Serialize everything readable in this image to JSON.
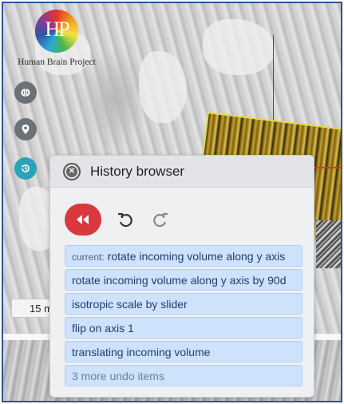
{
  "logo": {
    "mark": "HP",
    "text": "Human Brain Project"
  },
  "sidebar": {
    "buttons": [
      {
        "icon": "brain-icon"
      },
      {
        "icon": "map-pin-icon"
      },
      {
        "icon": "history-icon",
        "active": true
      }
    ]
  },
  "scale_label": "15 m",
  "history": {
    "title": "History browser",
    "close_icon": "close-icon",
    "controls": {
      "rewind_icon": "rewind-icon",
      "undo_icon": "undo-icon",
      "redo_icon": "redo-icon"
    },
    "current_prefix": "current:",
    "items": [
      "rotate incoming volume along y axis",
      "rotate incoming volume along y axis by 90d",
      "isotropic scale by slider",
      "flip on axis 1",
      "translating incoming volume"
    ],
    "more_label": "3 more undo items"
  },
  "colors": {
    "accent_red": "#d9383f",
    "active_teal": "#2aa3b8",
    "item_bg": "#cfe2fb",
    "frame_border": "#2f5597"
  }
}
